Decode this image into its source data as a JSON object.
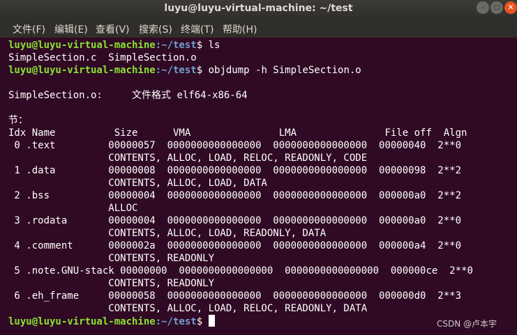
{
  "window": {
    "title": "luyu@luyu-virtual-machine: ~/test",
    "minimize_glyph": "–",
    "maximize_glyph": "□",
    "close_glyph": "✕"
  },
  "menu": [
    {
      "label": "文件(F)"
    },
    {
      "label": "编辑(E)"
    },
    {
      "label": "查看(V)"
    },
    {
      "label": "搜索(S)"
    },
    {
      "label": "终端(T)"
    },
    {
      "label": "帮助(H)"
    }
  ],
  "prompt": {
    "user_host": "luyu@luyu-virtual-machine",
    "path": ":~/test",
    "symbol": "$ "
  },
  "terminal": {
    "cmd1": "ls",
    "ls_output": "SimpleSection.c  SimpleSection.o",
    "cmd2": "objdump -h SimpleSection.o",
    "format_prefix": "SimpleSection.o:     ",
    "format_label": "文件格式",
    "format_value": " elf64-x86-64",
    "sections_label": "节：",
    "header": "Idx Name          Size      VMA               LMA               File off  Algn",
    "rows": [
      " 0 .text         00000057  0000000000000000  0000000000000000  00000040  2**0",
      "                 CONTENTS, ALLOC, LOAD, RELOC, READONLY, CODE",
      " 1 .data         00000008  0000000000000000  0000000000000000  00000098  2**2",
      "                 CONTENTS, ALLOC, LOAD, DATA",
      " 2 .bss          00000004  0000000000000000  0000000000000000  000000a0  2**2",
      "                 ALLOC",
      " 3 .rodata       00000004  0000000000000000  0000000000000000  000000a0  2**0",
      "                 CONTENTS, ALLOC, LOAD, READONLY, DATA",
      " 4 .comment      0000002a  0000000000000000  0000000000000000  000000a4  2**0",
      "                 CONTENTS, READONLY",
      " 5 .note.GNU-stack 00000000  0000000000000000  0000000000000000  000000ce  2**0",
      "                 CONTENTS, READONLY",
      " 6 .eh_frame     00000058  0000000000000000  0000000000000000  000000d0  2**3",
      "                 CONTENTS, ALLOC, LOAD, RELOC, READONLY, DATA"
    ]
  },
  "watermark": "CSDN @卢本宇"
}
